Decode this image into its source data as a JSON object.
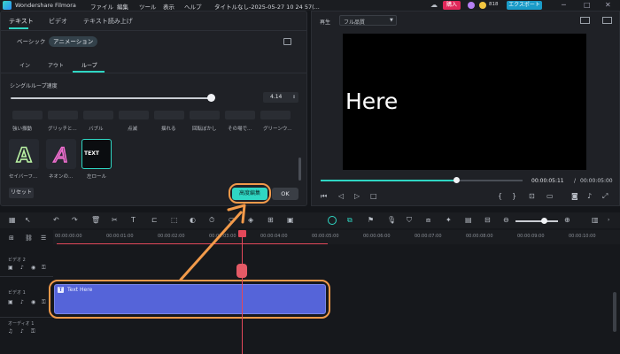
{
  "titlebar": {
    "app_name": "Wondershare Filmora",
    "menu": [
      "ファイル",
      "編集",
      "ツール",
      "表示",
      "ヘルプ"
    ],
    "doc_title": "タイトルなし-2025-05-27 10 24 57(...",
    "buy_label": "購入",
    "coin_count": "818",
    "export_label": "エクスポート",
    "win_controls": [
      "─",
      "□",
      "✕"
    ]
  },
  "left_panel": {
    "tabs": [
      "テキスト",
      "ビデオ",
      "テキスト読み上げ"
    ],
    "chips": [
      "ベーシック",
      "アニメーション"
    ],
    "subtabs": [
      "イン",
      "アウト",
      "ループ"
    ],
    "speed_label": "シングルループ速度",
    "speed_value": "4.14",
    "row1_captions": [
      "強い振動",
      "グリッチと...",
      "バブル",
      "点滅",
      "揺れる",
      "回転ぼかし",
      "その場で...",
      "グリーンウ..."
    ],
    "row2_captions": [
      "セイバーフ...",
      "ネオンの...",
      "左ロール"
    ],
    "thumb_text": "TEXT",
    "reset_label": "リセット",
    "advanced_label": "高度編集",
    "ok_label": "OK"
  },
  "right_panel": {
    "tab_label": "再生",
    "quality_label": "フル品質",
    "preview_text": "Here",
    "time_current": "00:00:05:11",
    "time_sep": "/",
    "time_total": "00:00:05:00"
  },
  "timeline": {
    "ticks": [
      "00:00:00:00",
      "00:00:01:00",
      "00:00:02:00",
      "00:00:03:00",
      "00:00:04:00",
      "00:00:05:00",
      "00:00:06:00",
      "00:00:07:00",
      "00:00:08:00",
      "00:00:09:00",
      "00:00:10:00"
    ],
    "track_labels": [
      "ビデオ 2",
      "ビデオ 1",
      "オーディオ 1"
    ],
    "clip_label": "Text Here"
  },
  "colors": {
    "accent": "#2fd6c3",
    "annotation": "#f29a4a",
    "playhead": "#e4485a",
    "clip": "#5564d9",
    "buy": "#e0285a",
    "export": "#1a9bc8"
  }
}
